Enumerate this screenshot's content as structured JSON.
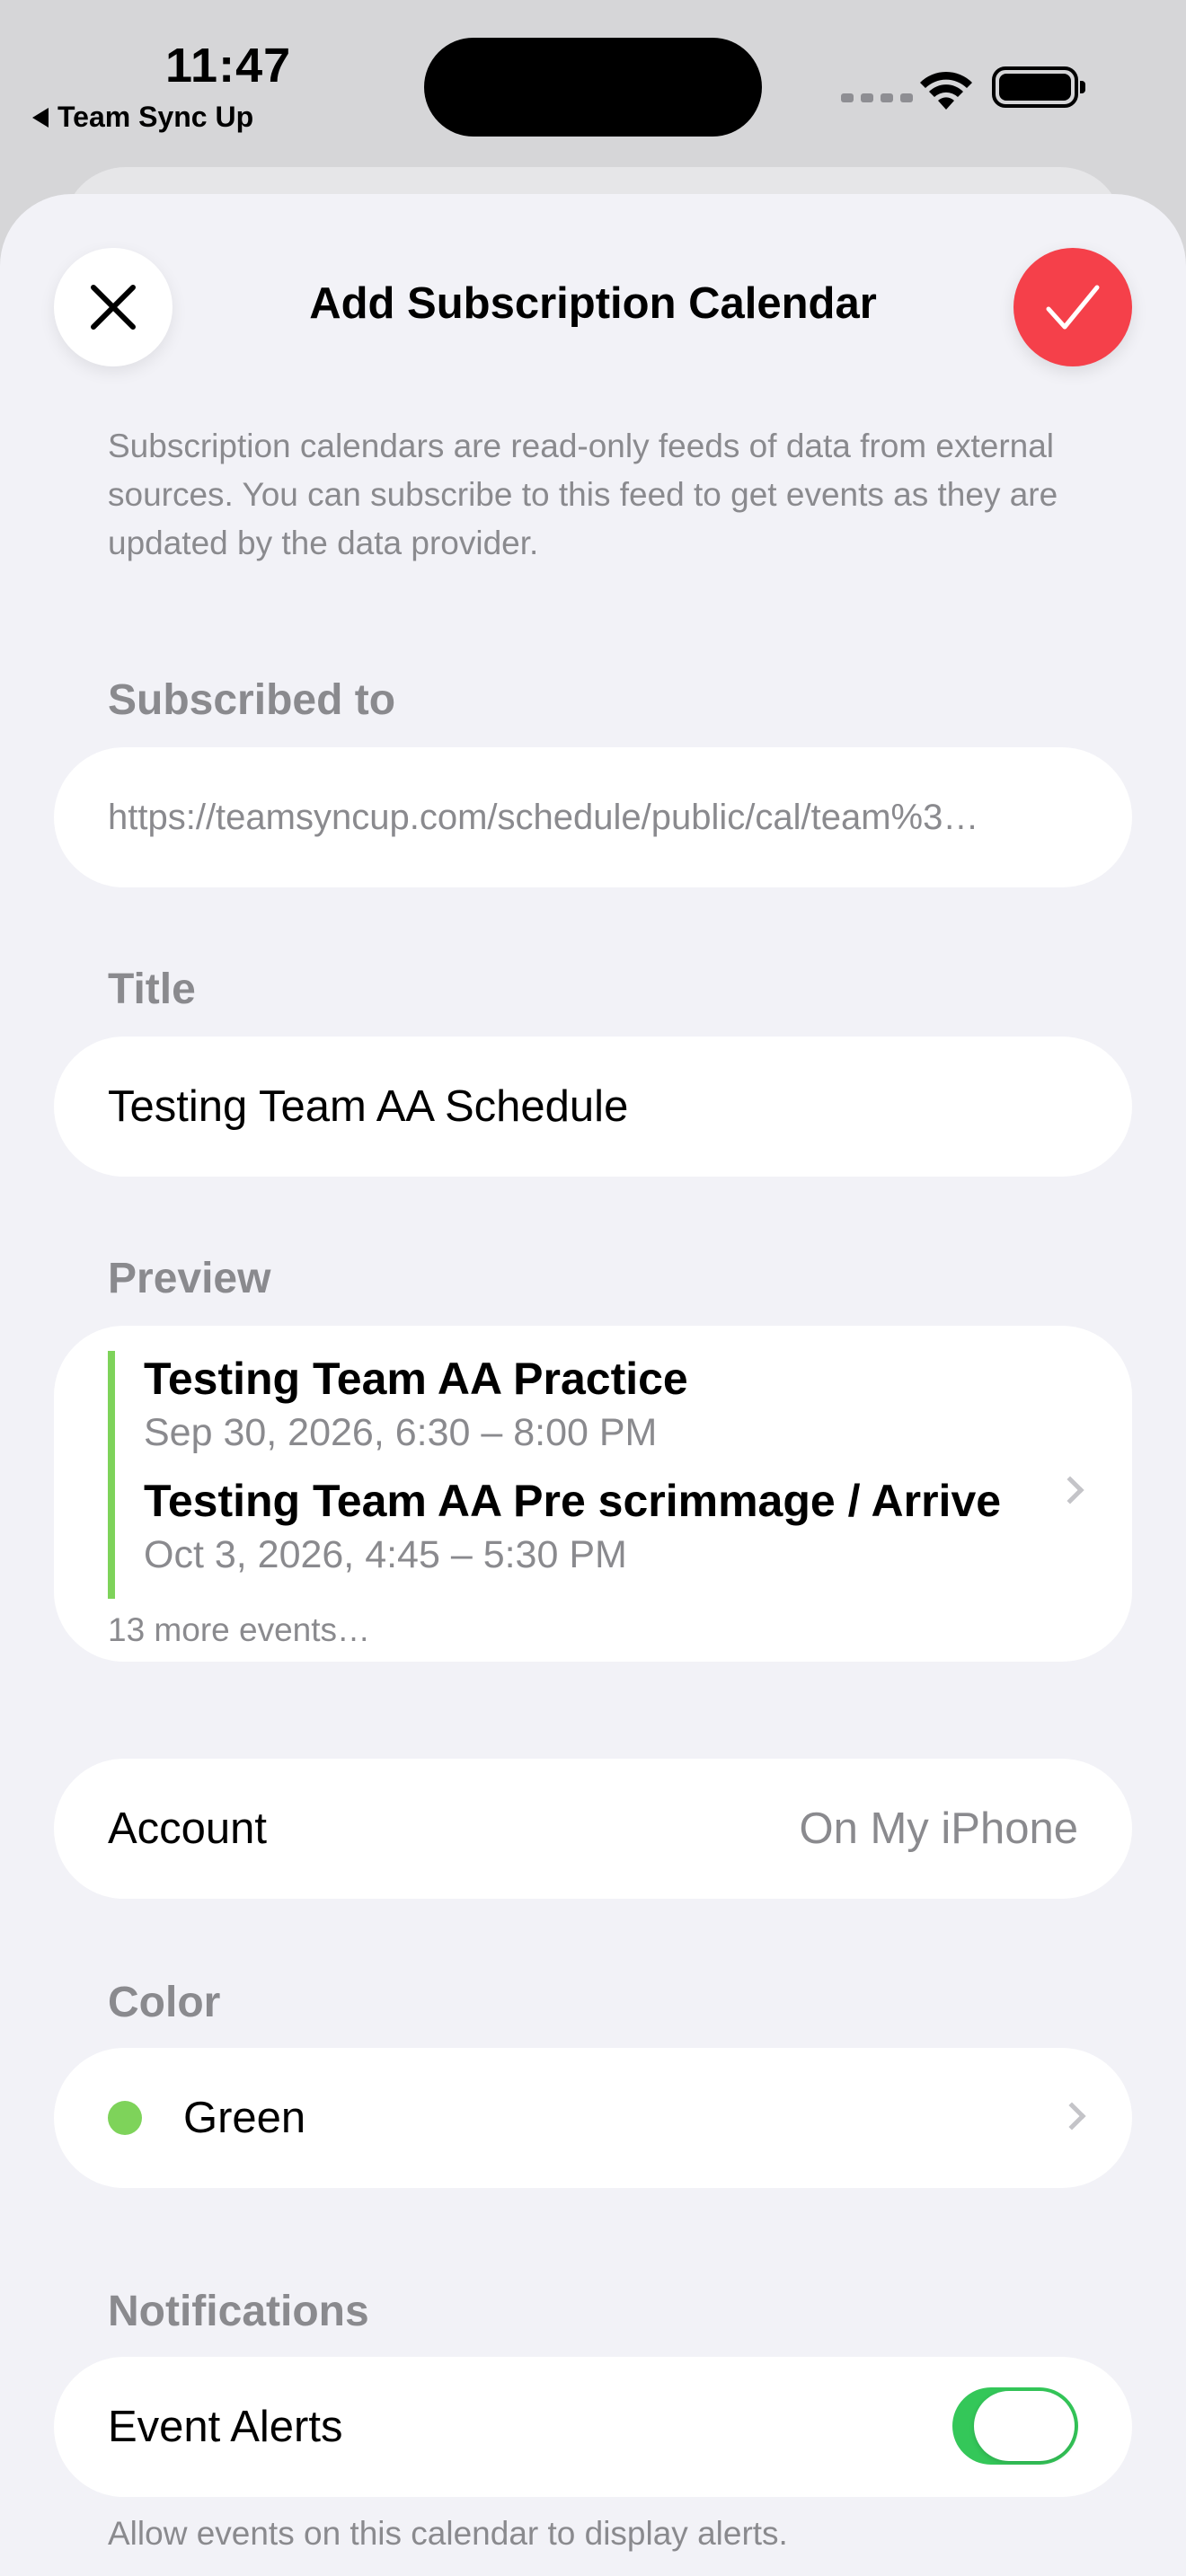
{
  "status_bar": {
    "time": "11:47",
    "back_app": "Team Sync Up"
  },
  "header": {
    "title": "Add Subscription Calendar",
    "close_icon": "close-icon",
    "confirm_icon": "checkmark-icon",
    "confirm_color": "#f5404a"
  },
  "description": "Subscription calendars are read-only feeds of data from external sources. You can subscribe to this feed to get events as they are updated by the data provider.",
  "subscribed_to": {
    "label": "Subscribed to",
    "value": "https://teamsyncup.com/schedule/public/cal/team%3…"
  },
  "title_field": {
    "label": "Title",
    "value": "Testing Team AA Schedule"
  },
  "preview": {
    "label": "Preview",
    "events": [
      {
        "title": "Testing Team AA Practice",
        "time": "Sep 30, 2026, 6:30 – 8:00 PM"
      },
      {
        "title": "Testing Team AA Pre scrimmage / Arrive",
        "time": "Oct 3, 2026, 4:45 – 5:30 PM"
      }
    ],
    "more": "13 more events…"
  },
  "account": {
    "label": "Account",
    "value": "On My iPhone"
  },
  "color": {
    "label": "Color",
    "value": "Green",
    "swatch": "#7ed35a"
  },
  "notifications": {
    "label": "Notifications",
    "event_alerts_label": "Event Alerts",
    "event_alerts_on": true,
    "footnote": "Allow events on this calendar to display alerts.",
    "toggle_color": "#34c759"
  }
}
